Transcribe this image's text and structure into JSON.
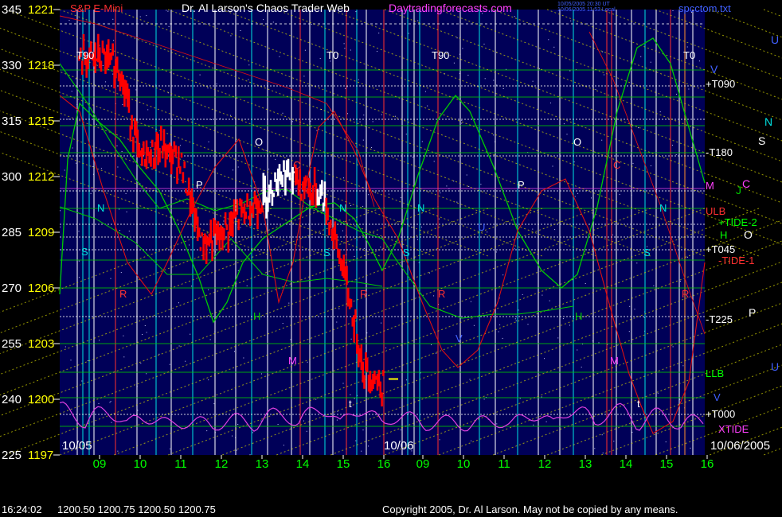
{
  "header": {
    "symbol": "S&P E-Mini",
    "title": "Dr. Al Larson's Chaos Trader Web",
    "site": "Daytradingforecasts.com",
    "stamp_line1": "10/05/2005 20:30 UT",
    "stamp_line2": "10/06/2005 11:53 Local",
    "file": "spcctom.txt"
  },
  "footer": {
    "quote_time": "16:24:02",
    "quote_values": "1200.50 1200.75 1200.50 1200.75",
    "copyright": "Copyright 2005, Dr. Al Larson. May not be copied by any means."
  },
  "colors": {
    "plot_bg": "#000058",
    "price_axis": "#ffff00",
    "degree_axis": "#ffffff",
    "hour_axis": "#00ff00",
    "price_bars": "#ff0000",
    "white_bars": "#ffffff",
    "grid_yellow": "#d8d800",
    "green_line": "#00cc00",
    "red_line": "#dd1010",
    "magenta_line": "#e040e0",
    "cyan": "#00e0e0"
  },
  "chart_data": {
    "type": "line",
    "title": "S&P E-Mini",
    "y_degrees": [
      345,
      330,
      315,
      300,
      285,
      270,
      255,
      240,
      225
    ],
    "y_prices": [
      1221,
      1218,
      1215,
      1212,
      1209,
      1206,
      1203,
      1200,
      1197
    ],
    "ylim": [
      1197,
      1221
    ],
    "x_hours": [
      "09",
      "10",
      "11",
      "12",
      "13",
      "14",
      "15",
      "16",
      "09",
      "10",
      "11",
      "12",
      "13",
      "14",
      "15",
      "16"
    ],
    "x_dates": [
      "10/05",
      "10/06",
      "10/06/2005"
    ],
    "session_markers": [
      "T90",
      "T0",
      "T90",
      "T0"
    ],
    "right_labels": [
      {
        "text": "+T090",
        "color": "#ffffff"
      },
      {
        "text": "-T180",
        "color": "#ffffff"
      },
      {
        "text": "M",
        "color": "#ff40ff"
      },
      {
        "text": "ULB",
        "color": "#ff3030"
      },
      {
        "text": "+TIDE-2",
        "color": "#00ff00"
      },
      {
        "text": "H",
        "color": "#00ff00"
      },
      {
        "text": "+T045",
        "color": "#ffffff"
      },
      {
        "text": "-TIDE-1",
        "color": "#ff3030"
      },
      {
        "text": "-T225",
        "color": "#ffffff"
      },
      {
        "text": "LLB",
        "color": "#00ff00"
      },
      {
        "text": "V",
        "color": "#4060ff"
      },
      {
        "text": "+T000",
        "color": "#ffffff"
      },
      {
        "text": "XTIDE",
        "color": "#ff40ff"
      }
    ],
    "planet_letters_outside": [
      "U",
      "V",
      "N",
      "S",
      "C",
      "J",
      "O",
      "P",
      "U"
    ],
    "day1_close_series": {
      "name": "S&P E-Mini",
      "hours": [
        8.5,
        9.0,
        9.5,
        10.0,
        10.5,
        11.0,
        11.5,
        12.0,
        12.5,
        13.0,
        13.5,
        14.0,
        14.5,
        15.0,
        15.5,
        16.0
      ],
      "values": [
        1218.3,
        1218.4,
        1217.9,
        1212.9,
        1213.6,
        1212.8,
        1208.4,
        1208.8,
        1210.1,
        1210.7,
        1212.3,
        1211.5,
        1211.0,
        1207.0,
        1201.7,
        1200.7
      ]
    },
    "last_price": 1200.75
  }
}
